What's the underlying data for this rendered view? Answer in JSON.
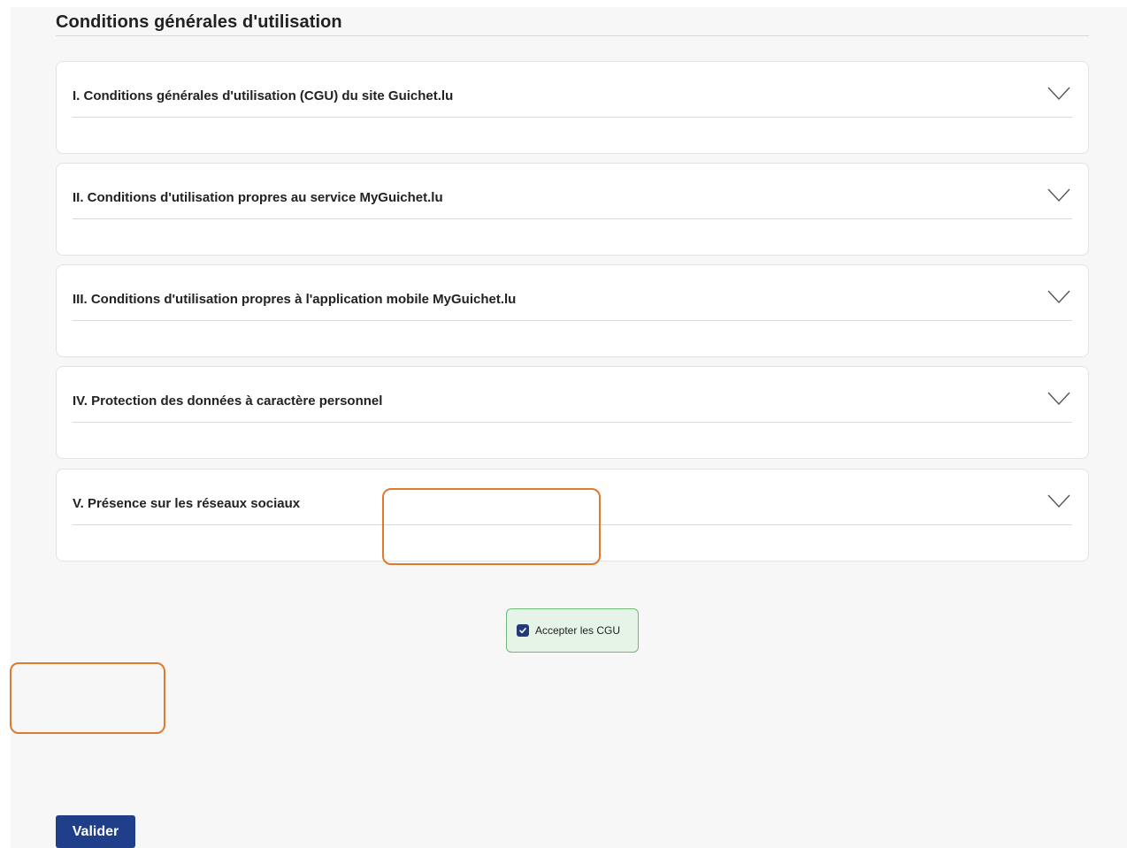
{
  "section": {
    "title": "Conditions générales d'utilisation"
  },
  "accordions": [
    {
      "label": "I. Conditions générales d'utilisation (CGU) du site Guichet.lu"
    },
    {
      "label": "II. Conditions d'utilisation propres au service MyGuichet.lu"
    },
    {
      "label": "III. Conditions d'utilisation propres à l'application mobile MyGuichet.lu"
    },
    {
      "label": "IV. Protection des données à caractère personnel"
    },
    {
      "label": "V. Présence sur les réseaux sociaux"
    }
  ],
  "consent": {
    "label": "Accepter les CGU",
    "checked": true
  },
  "actions": {
    "submit_label": "Valider"
  },
  "icons": {
    "accordion_toggle": "chevron-down-icon",
    "checkbox_mark": "checkmark-icon"
  },
  "colors": {
    "primary": "#1f3f8a",
    "consent_background": "#e6f3e7",
    "consent_border": "#6dbb77",
    "highlight_border": "#e07a2f"
  }
}
